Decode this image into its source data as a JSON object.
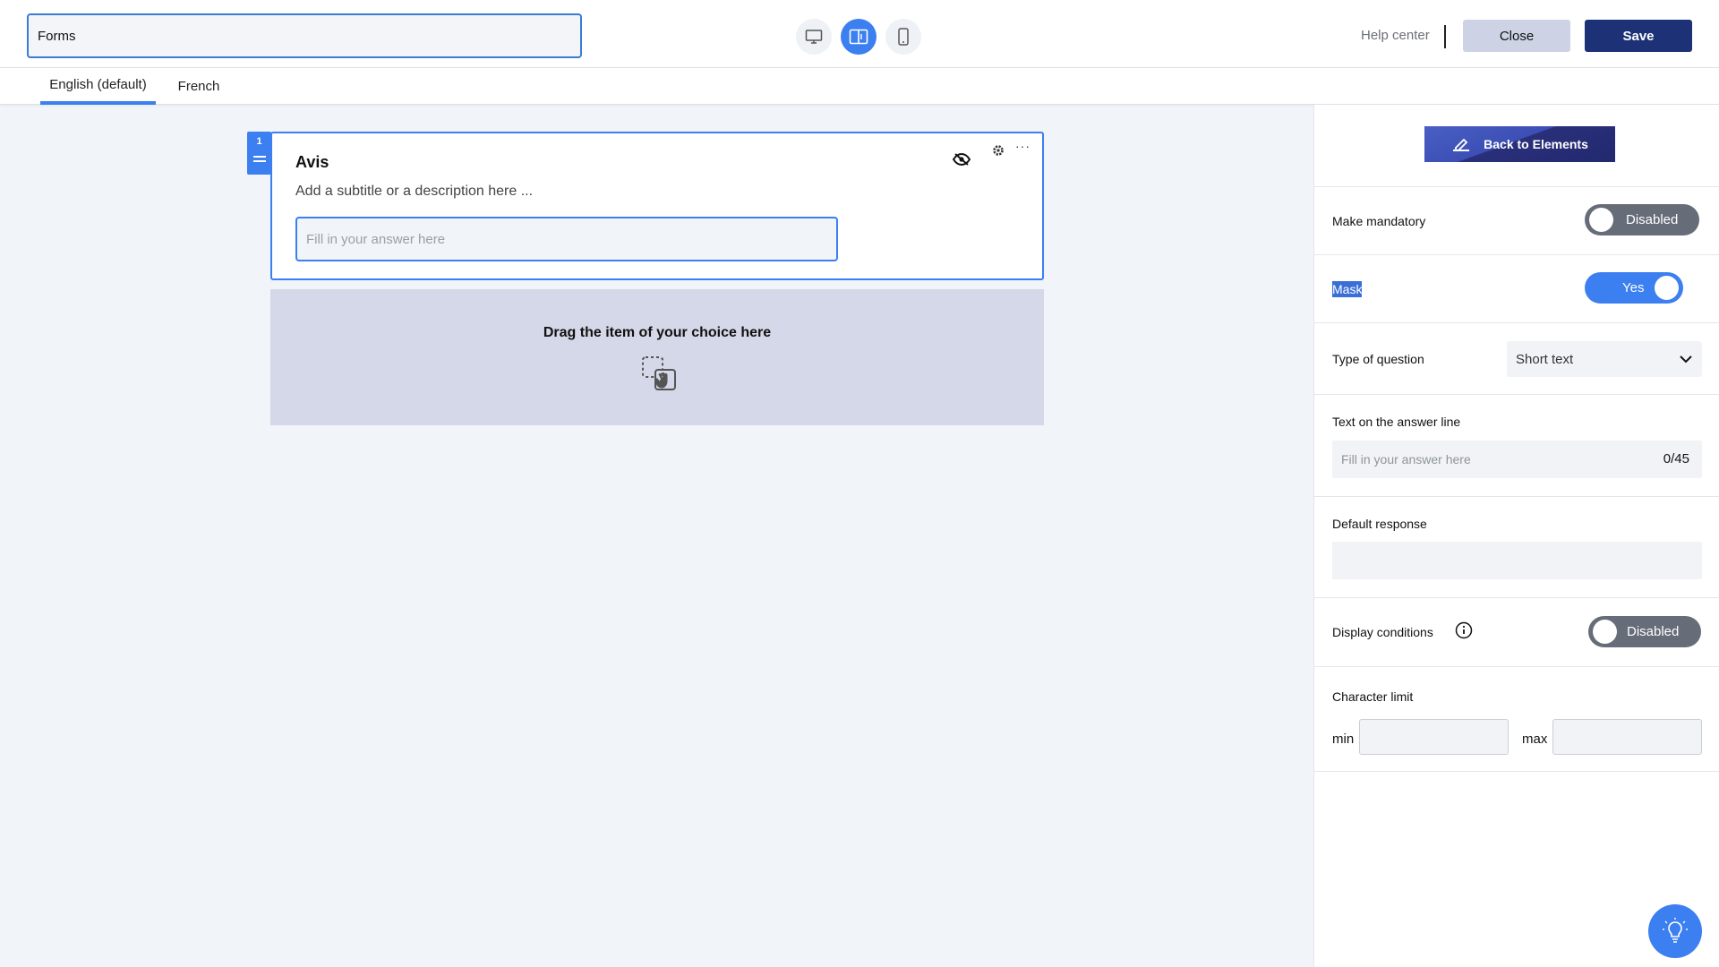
{
  "header": {
    "form_title": "Forms",
    "help_label": "Help center",
    "close_label": "Close",
    "save_label": "Save",
    "view_modes": [
      {
        "icon": "desktop-icon",
        "active": false
      },
      {
        "icon": "split-view-icon",
        "active": true
      },
      {
        "icon": "mobile-icon",
        "active": false
      }
    ]
  },
  "languages": {
    "tabs": [
      {
        "label": "English (default)",
        "active": true
      },
      {
        "label": "French",
        "active": false
      }
    ]
  },
  "canvas": {
    "question": {
      "number": "1",
      "title": "Avis",
      "subtitle": "Add a subtitle or a description here ...",
      "answer_placeholder": "Fill in your answer here",
      "actions": [
        "hidden-eye-icon",
        "gear-icon",
        "more-icon"
      ]
    },
    "dropzone": {
      "text": "Drag the item of your choice here",
      "icon": "drag-drop-icon"
    }
  },
  "panel": {
    "back_label": "Back to Elements",
    "mandatory": {
      "label": "Make mandatory",
      "state": "Disabled"
    },
    "mask": {
      "label": "Mask",
      "state": "Yes"
    },
    "question_type": {
      "label": "Type of question",
      "value": "Short text"
    },
    "answer_line": {
      "label": "Text on the answer line",
      "placeholder": "Fill in your answer here",
      "counter": "0/45"
    },
    "default_response": {
      "label": "Default response",
      "value": ""
    },
    "display_conditions": {
      "label": "Display conditions",
      "state": "Disabled"
    },
    "char_limit": {
      "label": "Character limit",
      "min_label": "min",
      "max_label": "max",
      "min_value": "",
      "max_value": ""
    }
  },
  "colors": {
    "accent": "#3b7ff0",
    "save": "#1d3276",
    "toggle_off": "#666c78",
    "dropzone": "#d4d8e8"
  }
}
